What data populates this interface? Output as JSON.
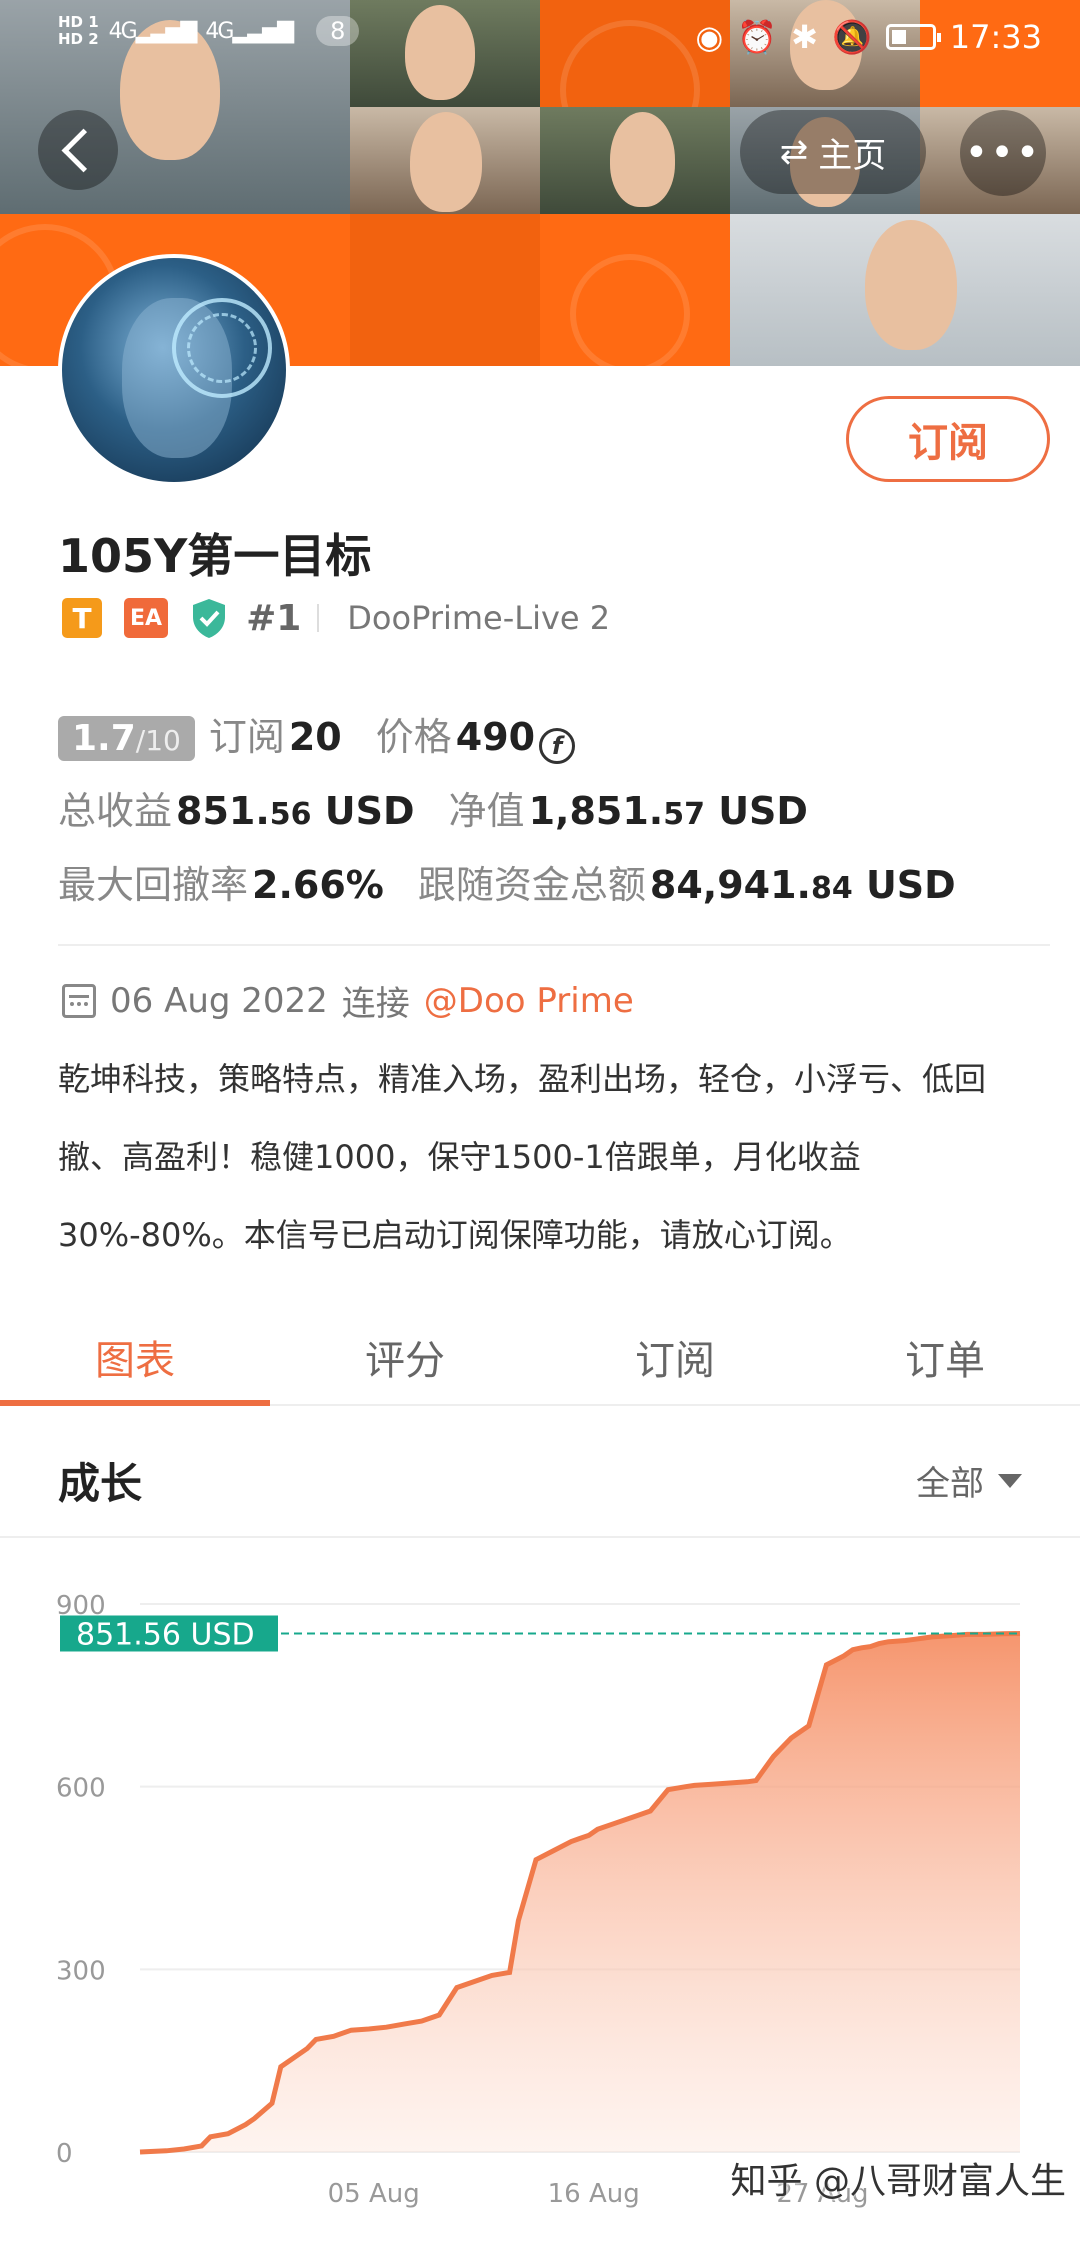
{
  "status_bar": {
    "hd1": "HD 1",
    "hd2": "HD 2",
    "net1": "4G",
    "net2": "4G",
    "notif_count": "8",
    "time": "17:33"
  },
  "header": {
    "home_label": "主页",
    "more_label": "•••"
  },
  "profile": {
    "subscribe_label": "订阅",
    "name": "105Y第一目标",
    "badge_t": "T",
    "badge_ea": "EA",
    "rank": "#1",
    "server": "DooPrime-Live 2"
  },
  "stats": {
    "score_main": "1.7",
    "score_suffix": "/10",
    "subs_label": "订阅",
    "subs_value": "20",
    "price_label": "价格",
    "price_value": "490",
    "coin_symbol": "f",
    "profit_label": "总收益",
    "profit_int": "851.",
    "profit_dec": "56",
    "profit_unit": "USD",
    "equity_label": "净值",
    "equity_int": "1,851.",
    "equity_dec": "57",
    "equity_unit": "USD",
    "drawdown_label": "最大回撤率",
    "drawdown_value": "2.66%",
    "follow_label": "跟随资金总额",
    "follow_int": "84,941.",
    "follow_dec": "84",
    "follow_unit": "USD"
  },
  "connection": {
    "date": "06 Aug 2022",
    "connect_label": "连接",
    "broker": "@Doo Prime"
  },
  "description": "乾坤科技，策略特点，精准入场，盈利出场，轻仓，小浮亏、低回撤、高盈利！稳健1000，保守1500-1倍跟单，月化收益30%-80%。本信号已启动订阅保障功能，请放心订阅。",
  "tabs": [
    {
      "label": "图表",
      "active": true
    },
    {
      "label": "评分",
      "active": false
    },
    {
      "label": "订阅",
      "active": false
    },
    {
      "label": "订单",
      "active": false
    }
  ],
  "section": {
    "title": "成长",
    "filter_label": "全部"
  },
  "chart_data": {
    "type": "area",
    "title": "",
    "xlabel": "",
    "ylabel": "",
    "ylim": [
      0,
      900
    ],
    "yticks": [
      0,
      300,
      600,
      900
    ],
    "xticks": [
      "05 Aug",
      "16 Aug",
      "27 Aug"
    ],
    "current_value": 851.56,
    "current_label": "851.56 USD",
    "colors": {
      "line": "#f07a4a",
      "fill": "#f7a384",
      "marker": "#17a88c"
    },
    "series": [
      {
        "x": [
          0,
          0.03,
          0.05,
          0.07,
          0.08,
          0.1,
          0.12,
          0.13,
          0.15,
          0.16,
          0.17,
          0.19,
          0.2,
          0.22,
          0.24,
          0.26,
          0.28,
          0.3,
          0.32,
          0.34,
          0.36,
          0.38,
          0.4,
          0.42,
          0.43,
          0.45,
          0.47,
          0.49,
          0.5,
          0.51,
          0.52,
          0.54,
          0.56,
          0.58,
          0.6,
          0.62,
          0.63,
          0.65,
          0.67,
          0.69,
          0.7,
          0.72,
          0.74,
          0.76,
          0.78,
          0.8,
          0.81,
          0.82,
          0.83,
          0.84,
          0.85,
          0.87,
          0.88,
          0.89,
          0.9,
          0.92,
          0.94,
          0.96,
          0.98,
          1.0
        ],
        "values": [
          0,
          2,
          5,
          10,
          25,
          30,
          45,
          55,
          80,
          140,
          150,
          170,
          185,
          190,
          200,
          202,
          205,
          210,
          215,
          225,
          270,
          280,
          290,
          295,
          380,
          480,
          495,
          510,
          515,
          520,
          530,
          540,
          550,
          560,
          595,
          600,
          602,
          604,
          606,
          608,
          610,
          650,
          680,
          700,
          800,
          815,
          825,
          828,
          830,
          835,
          838,
          840,
          842,
          844,
          846,
          848,
          850,
          850,
          851,
          851.56
        ]
      }
    ]
  },
  "watermark": "知乎 @八哥财富人生"
}
